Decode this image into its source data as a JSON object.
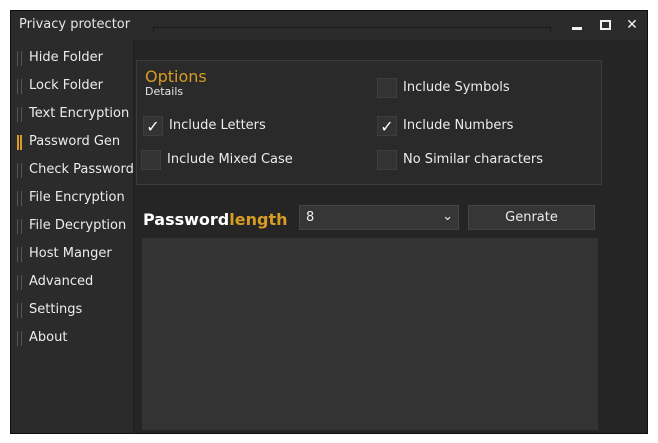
{
  "window": {
    "title": "Privacy protector",
    "controls": {
      "minimize": "",
      "maximize": "",
      "close": "✕"
    }
  },
  "sidebar": {
    "items": [
      {
        "label": "Hide Folder",
        "active": false
      },
      {
        "label": "Lock Folder",
        "active": false
      },
      {
        "label": "Text Encryption",
        "active": false
      },
      {
        "label": "Password Gen",
        "active": true
      },
      {
        "label": "Check Password",
        "active": false
      },
      {
        "label": "File Encryption",
        "active": false
      },
      {
        "label": "File Decryption",
        "active": false
      },
      {
        "label": "Host Manger",
        "active": false
      },
      {
        "label": "Advanced",
        "active": false
      },
      {
        "label": "Settings",
        "active": false
      },
      {
        "label": "About",
        "active": false
      }
    ]
  },
  "options": {
    "title": "Options",
    "subtitle": "Details",
    "checkboxes": {
      "letters": {
        "label": "Include Letters",
        "checked": true,
        "mark": "✓"
      },
      "mixed_case": {
        "label": "Include Mixed Case",
        "checked": false,
        "mark": ""
      },
      "symbols": {
        "label": "Include Symbols",
        "checked": false,
        "mark": ""
      },
      "numbers": {
        "label": "Include Numbers",
        "checked": true,
        "mark": "✓"
      },
      "no_similar": {
        "label": "No Similar characters",
        "checked": false,
        "mark": ""
      }
    }
  },
  "generator": {
    "label_part1": "Password",
    "label_part2": "length",
    "length_value": "8",
    "chevron": "⌄",
    "generate_label": "Genrate",
    "output_text": ""
  },
  "colors": {
    "accent": "#d79c22",
    "background": "#2b2b2b",
    "panel": "#252525"
  }
}
